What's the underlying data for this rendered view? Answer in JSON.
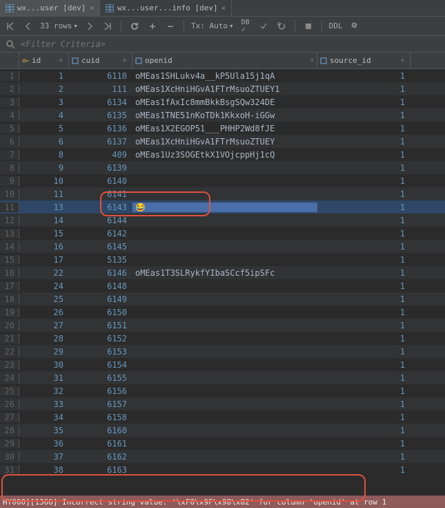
{
  "tabs": [
    {
      "label": "wx...user [dev]",
      "active": true
    },
    {
      "label": "wx...user...info [dev]",
      "active": false
    }
  ],
  "toolbar": {
    "rows_label": "33 rows",
    "tx_label": "Tx: Auto",
    "ddl_label": "DDL"
  },
  "filter": {
    "placeholder": "<Filter Criteria>"
  },
  "columns": {
    "id": "id",
    "cuid": "cuid",
    "openid": "openid",
    "source_id": "source_id"
  },
  "rows": [
    {
      "n": "1",
      "id": "1",
      "cuid": "6110",
      "openid": "oMEas1SHLukv4a__kP5Ula15j1qA",
      "src": "1"
    },
    {
      "n": "2",
      "id": "2",
      "cuid": "111",
      "openid": "oMEas1XcHniHGvA1FTrMsuoZTUEY1",
      "src": "1"
    },
    {
      "n": "3",
      "id": "3",
      "cuid": "6134",
      "openid": "oMEas1fAxIc8mmBkkBsgSQw324DE",
      "src": "1"
    },
    {
      "n": "4",
      "id": "4",
      "cuid": "6135",
      "openid": "oMEas1TNE51nKoTDk1KkxoH-iGGw",
      "src": "1"
    },
    {
      "n": "5",
      "id": "5",
      "cuid": "6136",
      "openid": "oMEas1X2EGOP51___PHHP2Wd8fJE",
      "src": "1"
    },
    {
      "n": "6",
      "id": "6",
      "cuid": "6137",
      "openid": "oMEas1XcHniHGvA1FTrMsuoZTUEY",
      "src": "1"
    },
    {
      "n": "7",
      "id": "8",
      "cuid": "409",
      "openid": "oMEas1Uz3SOGEtkX1VOjcppHj1cQ",
      "src": "1"
    },
    {
      "n": "8",
      "id": "9",
      "cuid": "6139",
      "openid": "",
      "src": "1"
    },
    {
      "n": "9",
      "id": "10",
      "cuid": "6140",
      "openid": "",
      "src": "1"
    },
    {
      "n": "10",
      "id": "11",
      "cuid": "6141",
      "openid": "",
      "src": "1"
    },
    {
      "n": "11",
      "id": "13",
      "cuid": "6143",
      "openid": "😂",
      "src": "1",
      "selected": true
    },
    {
      "n": "12",
      "id": "14",
      "cuid": "6144",
      "openid": "",
      "src": "1"
    },
    {
      "n": "13",
      "id": "15",
      "cuid": "6142",
      "openid": "",
      "src": "1"
    },
    {
      "n": "14",
      "id": "16",
      "cuid": "6145",
      "openid": "",
      "src": "1"
    },
    {
      "n": "15",
      "id": "17",
      "cuid": "5135",
      "openid": "",
      "src": "1"
    },
    {
      "n": "16",
      "id": "22",
      "cuid": "6146",
      "openid": "oMEas1T3SLRykfYIbaSCcf5ipSFc",
      "src": "1"
    },
    {
      "n": "17",
      "id": "24",
      "cuid": "6148",
      "openid": "",
      "src": "1"
    },
    {
      "n": "18",
      "id": "25",
      "cuid": "6149",
      "openid": "",
      "src": "1"
    },
    {
      "n": "19",
      "id": "26",
      "cuid": "6150",
      "openid": "",
      "src": "1"
    },
    {
      "n": "20",
      "id": "27",
      "cuid": "6151",
      "openid": "",
      "src": "1"
    },
    {
      "n": "21",
      "id": "28",
      "cuid": "6152",
      "openid": "",
      "src": "1"
    },
    {
      "n": "22",
      "id": "29",
      "cuid": "6153",
      "openid": "",
      "src": "1"
    },
    {
      "n": "23",
      "id": "30",
      "cuid": "6154",
      "openid": "",
      "src": "1"
    },
    {
      "n": "24",
      "id": "31",
      "cuid": "6155",
      "openid": "",
      "src": "1"
    },
    {
      "n": "25",
      "id": "32",
      "cuid": "6156",
      "openid": "",
      "src": "1"
    },
    {
      "n": "26",
      "id": "33",
      "cuid": "6157",
      "openid": "",
      "src": "1"
    },
    {
      "n": "27",
      "id": "34",
      "cuid": "6158",
      "openid": "",
      "src": "1"
    },
    {
      "n": "28",
      "id": "35",
      "cuid": "6160",
      "openid": "",
      "src": "1"
    },
    {
      "n": "29",
      "id": "36",
      "cuid": "6161",
      "openid": "",
      "src": "1"
    },
    {
      "n": "30",
      "id": "37",
      "cuid": "6162",
      "openid": "",
      "src": "1"
    },
    {
      "n": "31",
      "id": "38",
      "cuid": "6163",
      "openid": "",
      "src": "1"
    }
  ],
  "status": "HY000][1366] Incorrect string value: '\\xF0\\x9F\\x98\\x82' for column 'openid' at row 1"
}
